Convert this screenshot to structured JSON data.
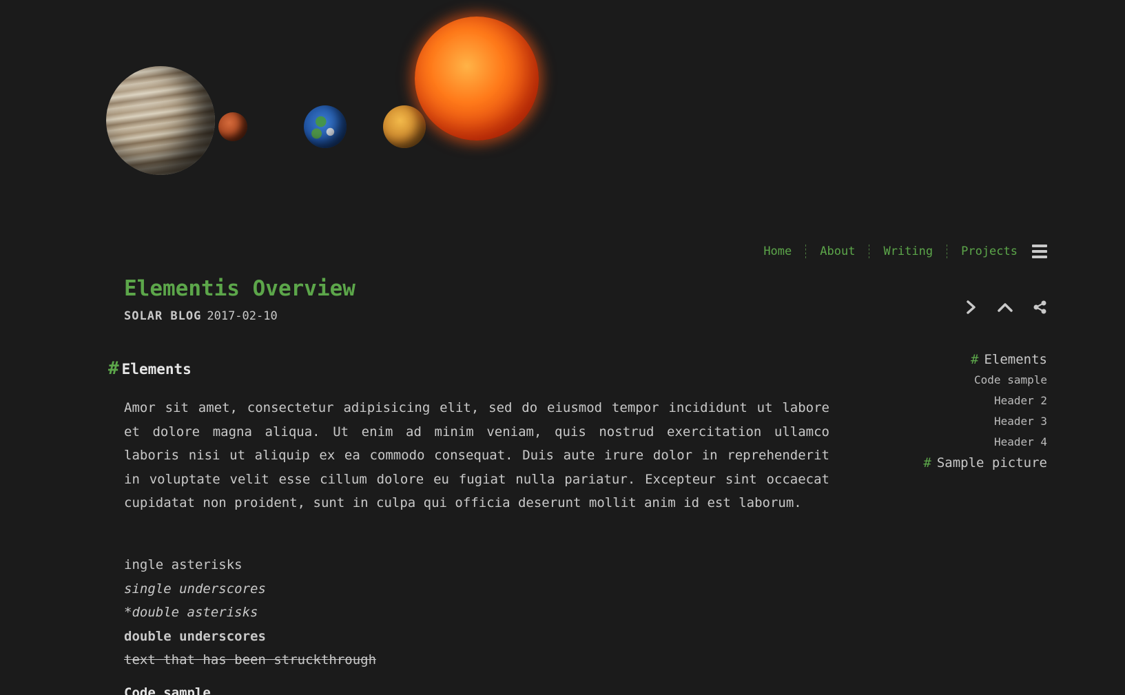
{
  "nav": {
    "items": [
      "Home",
      "About",
      "Writing",
      "Projects"
    ]
  },
  "post": {
    "title": "Elementis Overview",
    "author": "SOLAR BLOG",
    "date": "2017-02-10"
  },
  "toc": {
    "items": [
      {
        "level": 1,
        "hash": "#",
        "label": "Elements"
      },
      {
        "level": 2,
        "label": "Code sample"
      },
      {
        "level": 2,
        "label": "Header 2"
      },
      {
        "level": 2,
        "label": "Header 3"
      },
      {
        "level": 2,
        "label": "Header 4"
      },
      {
        "level": 1,
        "hash": "#",
        "label": "Sample picture"
      }
    ]
  },
  "article": {
    "section_hash": "#",
    "section_title": "Elements",
    "paragraph": "Amor sit amet, consectetur adipisicing elit, sed do eiusmod tempor incididunt ut labore et dolore magna aliqua. Ut enim ad minim veniam, quis nostrud exercitation ullamco laboris nisi ut aliquip ex ea commodo consequat. Duis aute irure dolor in reprehenderit in voluptate velit esse cillum dolore eu fugiat nulla pariatur. Excepteur sint occaecat cupidatat non proident, sunt in culpa qui officia deserunt mollit anim id est laborum.",
    "styles": {
      "single_asterisks": "ingle asterisks",
      "single_underscores": "single underscores",
      "double_asterisks": "*double asterisks",
      "double_underscores": "double underscores",
      "strikethrough": "text that has been struckthrough"
    },
    "next_subhead": "Code sample"
  },
  "colors": {
    "background": "#1b1b1b",
    "accent": "#5ca64a",
    "text": "#c9c9c9"
  },
  "icons": [
    "menu-icon",
    "next-post-icon",
    "scroll-top-icon",
    "share-icon"
  ]
}
